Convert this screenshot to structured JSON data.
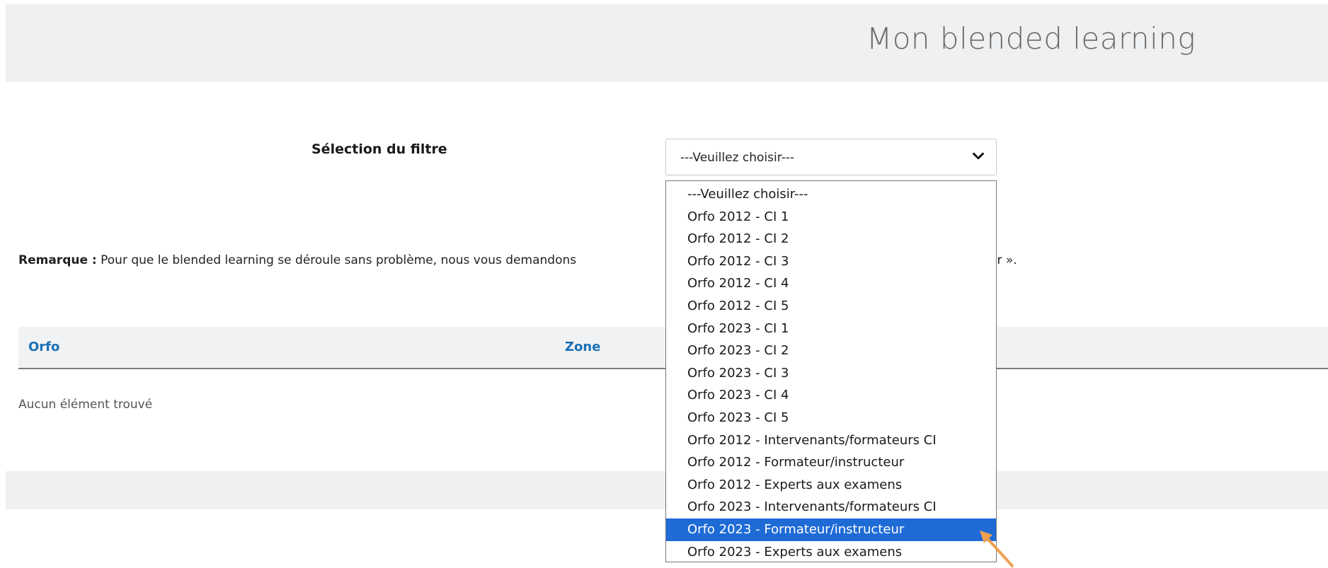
{
  "header": {
    "title": "Mon blended learning"
  },
  "filter": {
    "label": "Sélection du filtre",
    "selected_value": "---Veuillez choisir---",
    "options": [
      "---Veuillez choisir---",
      "Orfo 2012 - CI 1",
      "Orfo 2012 - CI 2",
      "Orfo 2012 - CI 3",
      "Orfo 2012 - CI 4",
      "Orfo 2012 - CI 5",
      "Orfo 2023 - CI 1",
      "Orfo 2023 - CI 2",
      "Orfo 2023 - CI 3",
      "Orfo 2023 - CI 4",
      "Orfo 2023 - CI 5",
      "Orfo 2012 - Intervenants/formateurs CI",
      "Orfo 2012 - Formateur/instructeur",
      "Orfo 2012 - Experts aux examens",
      "Orfo 2023 - Intervenants/formateurs CI",
      "Orfo 2023 - Formateur/instructeur",
      "Orfo 2023 - Experts aux examens"
    ],
    "highlighted_option": "Orfo 2023 - Formateur/instructeur"
  },
  "remark": {
    "label": "Remarque :",
    "text": "Pour que le blended learning se déroule sans problème, nous vous demandons",
    "text_tail": "er »."
  },
  "table": {
    "columns": [
      "Orfo",
      "Zone"
    ],
    "empty_message": "Aucun élément trouvé"
  },
  "colors": {
    "accent_link": "#1a6fb5",
    "highlight": "#1e6bd6",
    "annotation_arrow": "#f0a050",
    "band_bg": "#eef0f2"
  }
}
